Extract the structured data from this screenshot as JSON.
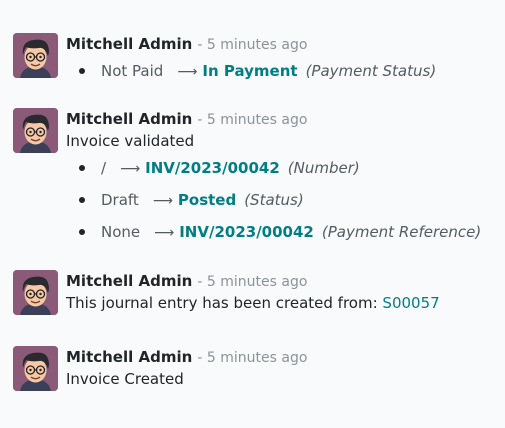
{
  "messages": [
    {
      "author": "Mitchell Admin",
      "date": "- 5 minutes ago",
      "changes": [
        {
          "old": "Not Paid",
          "arrow": "⟶",
          "new": "In Payment",
          "field": "(Payment Status)"
        }
      ]
    },
    {
      "author": "Mitchell Admin",
      "date": "- 5 minutes ago",
      "text": "Invoice validated",
      "changes": [
        {
          "old": "/",
          "arrow": "⟶",
          "new": "INV/2023/00042",
          "field": "(Number)"
        },
        {
          "old": "Draft",
          "arrow": "⟶",
          "new": "Posted",
          "field": "(Status)"
        },
        {
          "old": "None",
          "arrow": "⟶",
          "new": "INV/2023/00042",
          "field": "(Payment Reference)"
        }
      ]
    },
    {
      "author": "Mitchell Admin",
      "date": "- 5 minutes ago",
      "text": "This journal entry has been created from:",
      "link": "S00057"
    },
    {
      "author": "Mitchell Admin",
      "date": "- 5 minutes ago",
      "text": "Invoice Created"
    }
  ],
  "colors": {
    "background": "#f9fafb",
    "author": "#212529",
    "muted": "#8b929a",
    "accent": "#017e84",
    "avatar_bg": "#8b5a79"
  },
  "icons": {
    "avatar": "user-avatar-icon",
    "arrow": "long-arrow-right-icon"
  }
}
